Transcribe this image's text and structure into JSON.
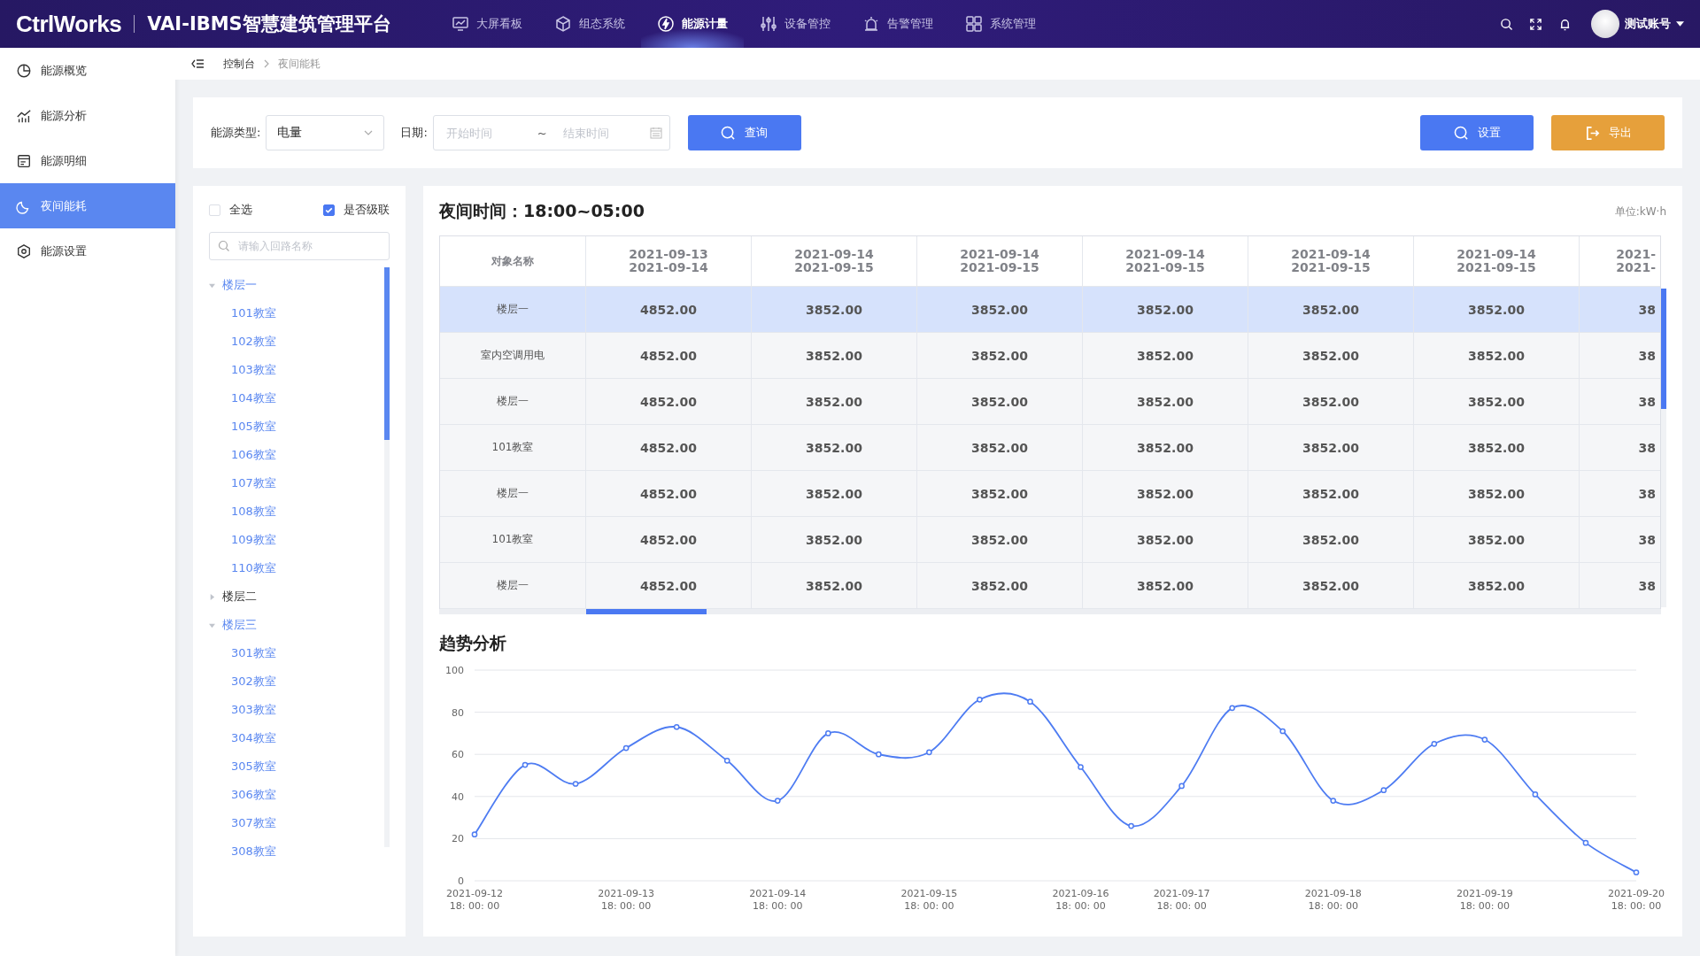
{
  "header": {
    "logo": "CtrlWorks",
    "platform": "VAI-IBMS智慧建筑管理平台",
    "nav": [
      {
        "label": "大屏看板",
        "selected": false
      },
      {
        "label": "组态系统",
        "selected": false
      },
      {
        "label": "能源计量",
        "selected": true
      },
      {
        "label": "设备管控",
        "selected": false
      },
      {
        "label": "告警管理",
        "selected": false
      },
      {
        "label": "系统管理",
        "selected": false
      }
    ],
    "user": "测试账号"
  },
  "sidebar": {
    "items": [
      {
        "label": "能源概览",
        "selected": false
      },
      {
        "label": "能源分析",
        "selected": false
      },
      {
        "label": "能源明细",
        "selected": false
      },
      {
        "label": "夜间能耗",
        "selected": true
      },
      {
        "label": "能源设置",
        "selected": false
      }
    ]
  },
  "breadcrumb": [
    "控制台",
    "夜间能耗"
  ],
  "filters": {
    "type_label": "能源类型:",
    "type_value": "电量",
    "date_label": "日期:",
    "start_placeholder": "开始时间",
    "range_sep": "~",
    "end_placeholder": "结束时间",
    "query": "查询",
    "settings": "设置",
    "export": "导出"
  },
  "tree": {
    "select_all": {
      "label": "全选",
      "checked": false
    },
    "cascade": {
      "label": "是否级联",
      "checked": true
    },
    "search_placeholder": "请输入回路名称",
    "nodes": [
      {
        "label": "楼层一",
        "expanded": true,
        "children": [
          {
            "label": "101教室"
          },
          {
            "label": "102教室"
          },
          {
            "label": "103教室"
          },
          {
            "label": "104教室"
          },
          {
            "label": "105教室"
          },
          {
            "label": "106教室"
          },
          {
            "label": "107教室"
          },
          {
            "label": "108教室"
          },
          {
            "label": "109教室"
          },
          {
            "label": "110教室"
          }
        ]
      },
      {
        "label": "楼层二",
        "expanded": false
      },
      {
        "label": "楼层三",
        "expanded": true,
        "children": [
          {
            "label": "301教室"
          },
          {
            "label": "302教室"
          },
          {
            "label": "303教室"
          },
          {
            "label": "304教室"
          },
          {
            "label": "305教室"
          },
          {
            "label": "306教室"
          },
          {
            "label": "307教室"
          },
          {
            "label": "308教室"
          }
        ]
      }
    ]
  },
  "table": {
    "title": "夜间时间：18:00~05:00",
    "unit": "单位:kW·h",
    "columns": [
      "对象名称",
      [
        "2021-09-13",
        "2021-09-14"
      ],
      [
        "2021-09-14",
        "2021-09-15"
      ],
      [
        "2021-09-14",
        "2021-09-15"
      ],
      [
        "2021-09-14",
        "2021-09-15"
      ],
      [
        "2021-09-14",
        "2021-09-15"
      ],
      [
        "2021-09-14",
        "2021-09-15"
      ],
      [
        "2021-",
        "2021-"
      ]
    ],
    "rows": [
      {
        "name": "楼层一",
        "selected": true,
        "values": [
          "4852.00",
          "3852.00",
          "3852.00",
          "3852.00",
          "3852.00",
          "3852.00",
          "38"
        ]
      },
      {
        "name": "室内空调用电",
        "selected": false,
        "values": [
          "4852.00",
          "3852.00",
          "3852.00",
          "3852.00",
          "3852.00",
          "3852.00",
          "38"
        ]
      },
      {
        "name": "楼层一",
        "selected": false,
        "values": [
          "4852.00",
          "3852.00",
          "3852.00",
          "3852.00",
          "3852.00",
          "3852.00",
          "38"
        ]
      },
      {
        "name": "101教室",
        "selected": false,
        "values": [
          "4852.00",
          "3852.00",
          "3852.00",
          "3852.00",
          "3852.00",
          "3852.00",
          "38"
        ]
      },
      {
        "name": "楼层一",
        "selected": false,
        "values": [
          "4852.00",
          "3852.00",
          "3852.00",
          "3852.00",
          "3852.00",
          "3852.00",
          "38"
        ]
      },
      {
        "name": "101教室",
        "selected": false,
        "values": [
          "4852.00",
          "3852.00",
          "3852.00",
          "3852.00",
          "3852.00",
          "3852.00",
          "38"
        ]
      },
      {
        "name": "楼层一",
        "selected": false,
        "values": [
          "4852.00",
          "3852.00",
          "3852.00",
          "3852.00",
          "3852.00",
          "3852.00",
          "38"
        ]
      }
    ]
  },
  "trend": {
    "title": "趋势分析",
    "chart_data": {
      "type": "line",
      "categories": [
        "2021-09-12 18: 00: 00",
        null,
        null,
        "2021-09-13 18: 00: 00",
        null,
        null,
        "2021-09-14 18: 00: 00",
        null,
        null,
        "2021-09-15 18: 00: 00",
        null,
        null,
        "2021-09-16 18: 00: 00",
        null,
        "2021-09-17 18: 00: 00",
        null,
        null,
        "2021-09-18 18: 00: 00",
        null,
        null,
        "2021-09-19 18: 00: 00",
        null,
        null,
        "2021-09-20 18: 00: 00"
      ],
      "grid": true,
      "series": [
        {
          "color": "#4e7cf2",
          "marker": true,
          "values": [
            22,
            55,
            46,
            63,
            73,
            57,
            38,
            70,
            60,
            61,
            86,
            85,
            54,
            26,
            45,
            82,
            71,
            38,
            43,
            65,
            67,
            41,
            18,
            4
          ]
        }
      ],
      "ylim": [
        0,
        100
      ],
      "yticks": [
        0,
        20,
        40,
        60,
        80,
        100
      ]
    }
  }
}
